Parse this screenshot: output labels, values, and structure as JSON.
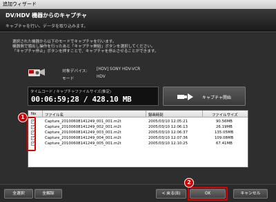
{
  "window": {
    "title": "追加ウィザード"
  },
  "header": {
    "title": "DV/HDV 機器からのキャプチャ",
    "subtitle": "キャプチャを行い、データを取り込みます。"
  },
  "instructions": [
    "選択された機器から以下のモードでキャプチャを行います。",
    "機器側で頭出し操作を行ったあと「キャプチャ開始」ボタンを選択してください。",
    "「キャプチャ停止」ボタンを押すことで、キャプチャを停止させることができます。"
  ],
  "device": {
    "target_label": "対象デバイス:",
    "target_value": "[HDV] SONY HDV-VCR",
    "mode_label": "モード",
    "mode_value": "HDV"
  },
  "timecode": {
    "label": "タイムコード / キャプチャファイルサイズ(推定)",
    "value": "00:06:59;28 / 428.10 MB"
  },
  "capture_button": {
    "label": "キャプチャ開始"
  },
  "file_list": {
    "columns": {
      "no": "No",
      "name": "ファイル名",
      "time": "録画時刻",
      "size": "ファイルサイズ"
    },
    "rows": [
      {
        "no": "1",
        "name": "Capture_20100608141249_001_001.m2t",
        "time": "2005/03/10 12:05:21",
        "size": "90.56MB"
      },
      {
        "no": "2",
        "name": "Capture_20100608141249_002_001.m2t",
        "time": "2005/03/10 12:06:13",
        "size": "26.19MB"
      },
      {
        "no": "3",
        "name": "Capture_20100608141249_003_001.m2t",
        "time": "2005/03/10 12:06:37",
        "size": "135.05MB"
      },
      {
        "no": "4",
        "name": "Capture_20100608141249_004_001.m2t",
        "time": "2005/03/10 12:07:36",
        "size": "109.08MB"
      },
      {
        "no": "5",
        "name": "Capture_20100608141249_005_001.m2t",
        "time": "2005/03/10 12:10:25",
        "size": "67.41MB"
      }
    ]
  },
  "callouts": {
    "one": "1",
    "two": "2"
  },
  "footer": {
    "select_all": "全選択",
    "deselect_all": "全解除",
    "back": "< 戻る(B)",
    "ok": "OK",
    "cancel": "キャンセル"
  }
}
